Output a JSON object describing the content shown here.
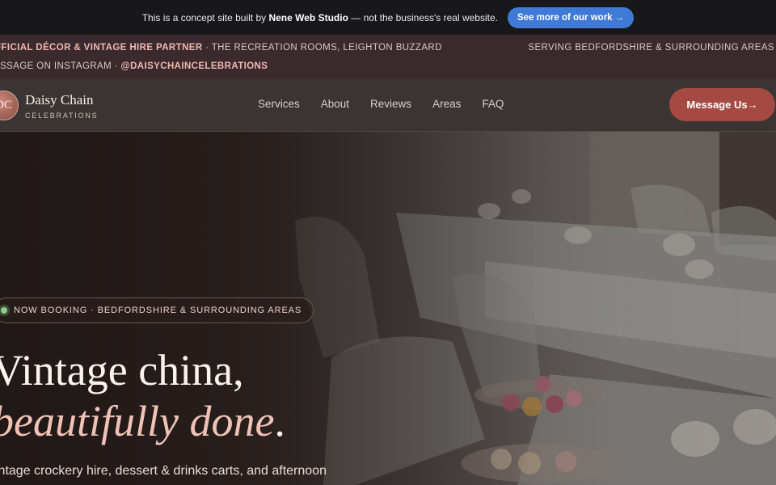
{
  "concept_bar": {
    "text_before": "This is a concept site built by",
    "studio": "Nene Web Studio",
    "text_after": "— not the business's real website.",
    "button": "See more of our work →"
  },
  "strip": {
    "partner": "FFICIAL DÉCOR & VINTAGE HIRE PARTNER",
    "venue": " · THE RECREATION ROOMS, LEIGHTON BUZZARD",
    "serving": "SERVING BEDFORDSHIRE & SURROUNDING AREAS",
    "message_prefix": "ESSAGE ON INSTAGRAM · ",
    "handle": "@DAISYCHAINCELEBRATIONS"
  },
  "nav": {
    "logo_initials": "DC",
    "brand": "Daisy Chain",
    "brand_sub": "CELEBRATIONS",
    "links": [
      "Services",
      "About",
      "Reviews",
      "Areas",
      "FAQ"
    ],
    "cta": "Message Us→"
  },
  "hero": {
    "badge": "NOW BOOKING · BEDFORDSHIRE & SURROUNDING AREAS",
    "headline_1": "Vintage china,",
    "headline_2": "beautifully done",
    "headline_2_end": ".",
    "lead": "intage crockery hire, dessert & drinks carts, and afternoon"
  },
  "colors": {
    "accent": "#a44a42",
    "pink": "#f0c2b6",
    "link_blue": "#3f7ad6"
  }
}
